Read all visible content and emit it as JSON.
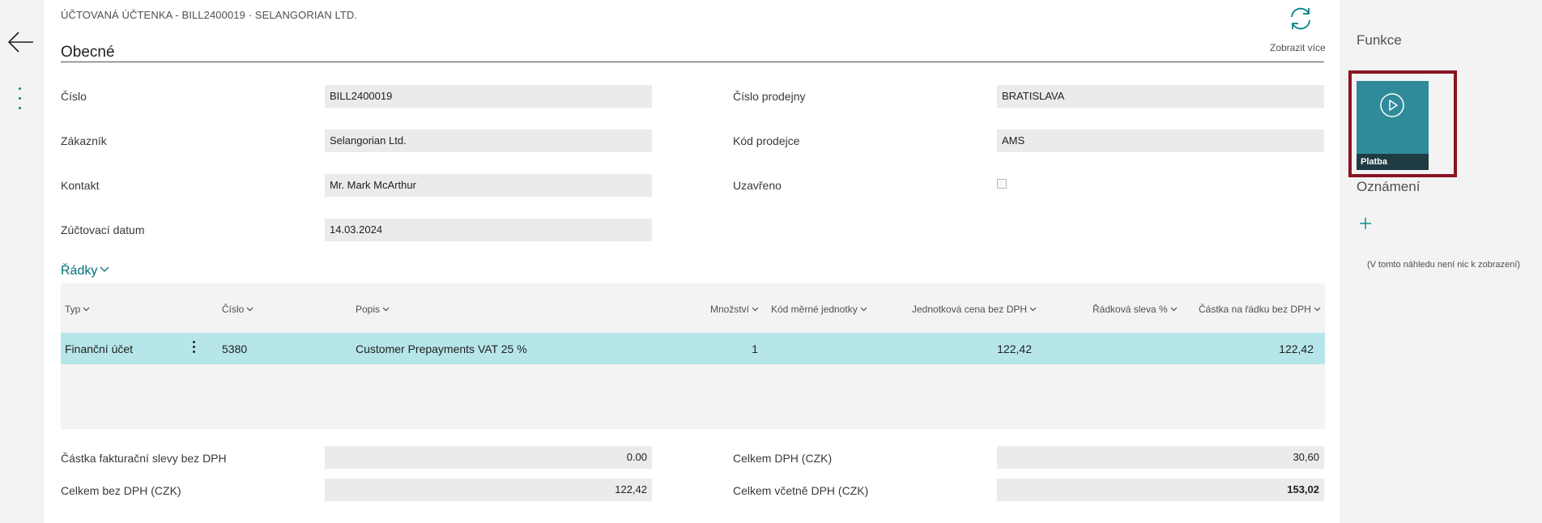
{
  "header": {
    "breadcrumb": "ÚČTOVANÁ ÚČTENKA - BILL2400019 · SELANGORIAN LTD.",
    "show_more": "Zobrazit více",
    "section_title": "Obecné"
  },
  "general": {
    "number_label": "Číslo",
    "number_value": "BILL2400019",
    "customer_label": "Zákazník",
    "customer_value": "Selangorian Ltd.",
    "contact_label": "Kontakt",
    "contact_value": "Mr. Mark McArthur",
    "posting_date_label": "Zúčtovací datum",
    "posting_date_value": "14.03.2024",
    "store_label": "Číslo prodejny",
    "store_value": "BRATISLAVA",
    "salesperson_label": "Kód prodejce",
    "salesperson_value": "AMS",
    "closed_label": "Uzavřeno",
    "closed_value": false
  },
  "lines": {
    "title": "Řádky",
    "columns": {
      "type": "Typ",
      "number": "Číslo",
      "description": "Popis",
      "quantity": "Množství",
      "uom": "Kód měrné jednotky",
      "unit_price": "Jednotková cena bez DPH",
      "discount": "Řádková sleva %",
      "amount": "Částka na řádku bez DPH"
    },
    "rows": [
      {
        "type": "Finanční účet",
        "number": "5380",
        "description": "Customer Prepayments VAT 25 %",
        "quantity": "1",
        "uom": "",
        "unit_price": "122,42",
        "discount": "",
        "amount": "122,42"
      }
    ]
  },
  "totals": {
    "invoice_discount_label": "Částka fakturační slevy bez DPH",
    "invoice_discount_value": "0.00",
    "total_excl_vat_label": "Celkem bez DPH (CZK)",
    "total_excl_vat_value": "122,42",
    "total_vat_label": "Celkem DPH (CZK)",
    "total_vat_value": "30,60",
    "total_incl_vat_label": "Celkem včetně DPH (CZK)",
    "total_incl_vat_value": "153,02"
  },
  "side_panel": {
    "functions_title": "Funkce",
    "tile_label": "Platba",
    "notices_title": "Oznámení",
    "empty_text": "(V tomto náhledu není nic k zobrazení)"
  },
  "colors": {
    "accent": "#008489",
    "tile": "#2f8b9a",
    "selected_row": "#b6e6ea",
    "highlight_border": "#8a1522"
  }
}
